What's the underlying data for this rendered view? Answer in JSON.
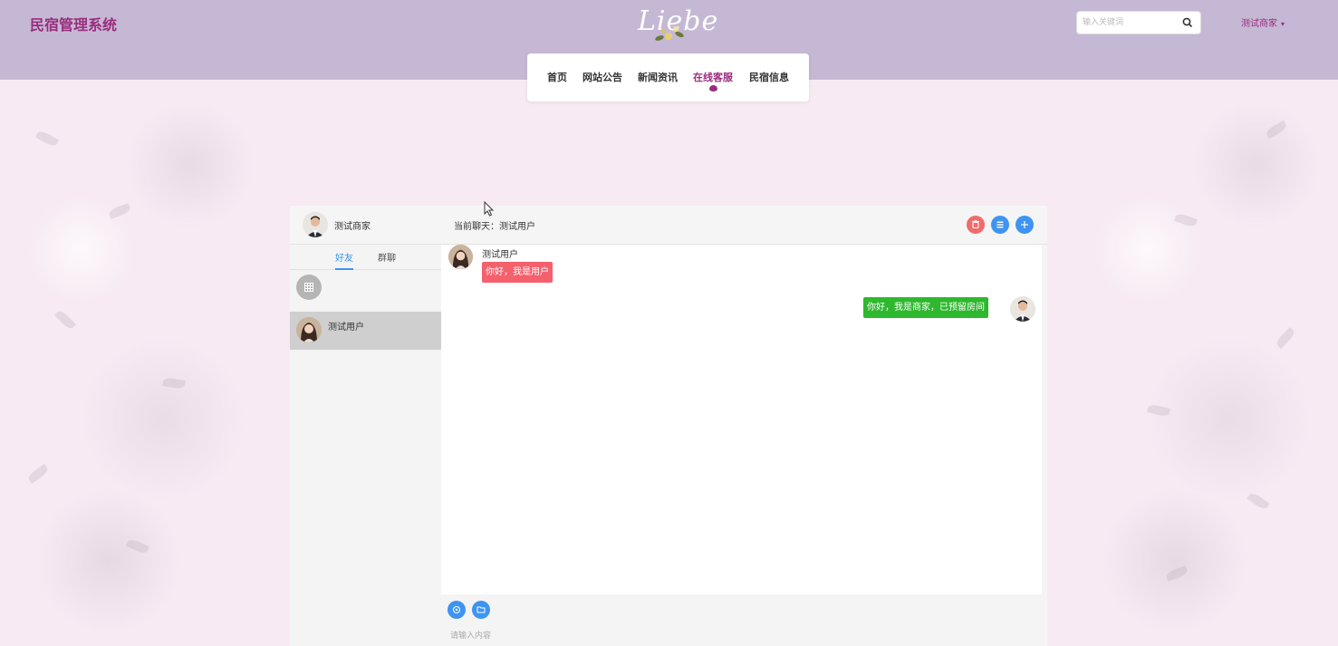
{
  "header": {
    "brand": "民宿管理系统",
    "logo_text": "Liebe",
    "search_placeholder": "输入关键词",
    "user_name": "测试商家"
  },
  "nav": {
    "items": [
      {
        "label": "首页"
      },
      {
        "label": "网站公告"
      },
      {
        "label": "新闻资讯"
      },
      {
        "label": "在线客服"
      },
      {
        "label": "民宿信息"
      }
    ],
    "active": "在线客服"
  },
  "chat": {
    "me_name": "测试商家",
    "current_chat": "当前聊天：测试用户",
    "tabs": {
      "friends": "好友",
      "groups": "群聊"
    },
    "contacts": [
      {
        "name": "测试用户"
      }
    ],
    "messages": [
      {
        "side": "left",
        "name": "测试用户",
        "text": "你好，我是用户"
      },
      {
        "side": "right",
        "text": "你好，我是商家，已预留房间"
      }
    ],
    "input_placeholder": "请输入内容"
  },
  "colors": {
    "header_bg": "#c5b8d4",
    "brand": "#9a2d7d",
    "accent_blue": "#3e94f0",
    "bubble_left": "#f4606c",
    "bubble_right": "#2eb82e",
    "delete_btn": "#f06b6b"
  },
  "icons": {
    "search": "search-icon",
    "delete": "trash-icon",
    "menu": "list-icon",
    "add": "plus-icon",
    "grid": "grid-icon",
    "emoji": "emoji-icon",
    "folder": "folder-icon"
  }
}
